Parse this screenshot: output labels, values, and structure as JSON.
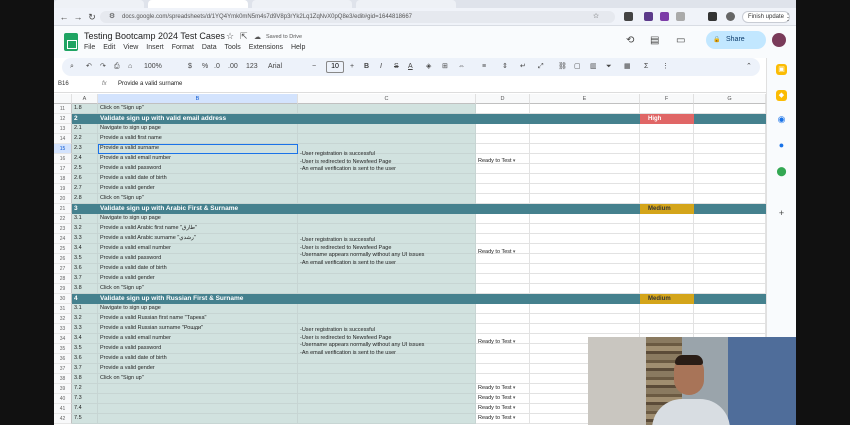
{
  "browser": {
    "url": "docs.google.com/spreadsheets/d/1YQ4Ymk0mN5m4s7d9V8p3rYk2Lq1ZqNvX0pQ8e3/edit#gid=1644818667",
    "finish_update": "Finish update"
  },
  "doc": {
    "title": "Testing Bootcamp 2024 Test Cases",
    "saved": "Saved to Drive",
    "menus": [
      "File",
      "Edit",
      "View",
      "Insert",
      "Format",
      "Data",
      "Tools",
      "Extensions",
      "Help"
    ],
    "share": "Share"
  },
  "toolbar": {
    "zoom": "100%",
    "currency": "$",
    "percent": "%",
    "dec_dec": ".0",
    "dec_inc": ".00",
    "format": "123",
    "font": "Arial",
    "font_size": "10",
    "bold": "B",
    "italic": "I",
    "strike": "S",
    "text_color": "A"
  },
  "formula_bar": {
    "cell": "B16",
    "fx": "fx",
    "content": "Provide a valid surname"
  },
  "columns": [
    "A",
    "B",
    "C",
    "D",
    "E",
    "F",
    "G"
  ],
  "rows": [
    {
      "n": "11",
      "type": "step",
      "a": "1.8",
      "b": "Click on \"Sign up\""
    },
    {
      "n": "12",
      "type": "section",
      "a": "2",
      "b": "Validate sign up with valid email address",
      "priority": "High",
      "pclass": "high"
    },
    {
      "n": "13",
      "type": "step",
      "a": "2.1",
      "b": "Navigate to sign up page"
    },
    {
      "n": "14",
      "type": "step",
      "a": "2.2",
      "b": "Provide a valid first name"
    },
    {
      "n": "15",
      "type": "step",
      "a": "2.3",
      "b": "Provide a valid surname",
      "selected": true
    },
    {
      "n": "16",
      "type": "step",
      "a": "2.4",
      "b": "Provide a valid email number"
    },
    {
      "n": "17",
      "type": "step",
      "a": "2.5",
      "b": "Provide a valid password"
    },
    {
      "n": "18",
      "type": "step",
      "a": "2.6",
      "b": "Provide a valid date of birth"
    },
    {
      "n": "19",
      "type": "step",
      "a": "2.7",
      "b": "Provide a valid gender"
    },
    {
      "n": "20",
      "type": "step",
      "a": "2.8",
      "b": "Click on \"Sign up\""
    },
    {
      "n": "21",
      "type": "section",
      "a": "3",
      "b": "Validate sign up with Arabic First & Surname",
      "priority": "Medium",
      "pclass": "med"
    },
    {
      "n": "22",
      "type": "step",
      "a": "3.1",
      "b": "Navigate to sign up page"
    },
    {
      "n": "23",
      "type": "step",
      "a": "3.2",
      "b": "Provide a valid Arabic first name \"طارق\""
    },
    {
      "n": "24",
      "type": "step",
      "a": "3.3",
      "b": "Provide a valid Arabic surname \"رشدي\""
    },
    {
      "n": "25",
      "type": "step",
      "a": "3.4",
      "b": "Provide a valid email number"
    },
    {
      "n": "26",
      "type": "step",
      "a": "3.5",
      "b": "Provide a valid password"
    },
    {
      "n": "27",
      "type": "step",
      "a": "3.6",
      "b": "Provide a valid date of birth"
    },
    {
      "n": "28",
      "type": "step",
      "a": "3.7",
      "b": "Provide a valid gender"
    },
    {
      "n": "29",
      "type": "step",
      "a": "3.8",
      "b": "Click on \"Sign up\""
    },
    {
      "n": "30",
      "type": "section",
      "a": "4",
      "b": "Validate sign up with Russian First & Surname",
      "priority": "Medium",
      "pclass": "med"
    },
    {
      "n": "31",
      "type": "step",
      "a": "3.1",
      "b": "Navigate to sign up page"
    },
    {
      "n": "32",
      "type": "step",
      "a": "3.2",
      "b": "Provide a valid Russian first name \"Тарека\""
    },
    {
      "n": "33",
      "type": "step",
      "a": "3.3",
      "b": "Provide a valid Russian surname \"Рошди\""
    },
    {
      "n": "34",
      "type": "step",
      "a": "3.4",
      "b": "Provide a valid email number"
    },
    {
      "n": "35",
      "type": "step",
      "a": "3.5",
      "b": "Provide a valid password"
    },
    {
      "n": "36",
      "type": "step",
      "a": "3.6",
      "b": "Provide a valid date of birth"
    },
    {
      "n": "37",
      "type": "step",
      "a": "3.7",
      "b": "Provide a valid gender"
    },
    {
      "n": "38",
      "type": "step",
      "a": "3.8",
      "b": "Click on \"Sign up\""
    },
    {
      "n": "39",
      "type": "step",
      "a": "7.2",
      "b": "",
      "status": "Ready to Test"
    },
    {
      "n": "40",
      "type": "step",
      "a": "7.3",
      "b": "",
      "status": "Ready to Test"
    },
    {
      "n": "41",
      "type": "step",
      "a": "7.4",
      "b": "",
      "status": "Ready to Test"
    },
    {
      "n": "42",
      "type": "step",
      "a": "7.5",
      "b": "",
      "status": "Ready to Test"
    }
  ],
  "expected": [
    {
      "lines": [
        "-User registration is successful",
        "-User is redirected to Newsfeed Page",
        "-An email verification is sent to the user"
      ],
      "status": "Ready to Test"
    },
    {
      "lines": [
        "-User registration is successful",
        "-User is redirected to Newsfeed Page",
        "-Username appears normally without any UI issues",
        "-An email verification is sent to the user"
      ],
      "status": "Ready to Test"
    },
    {
      "lines": [
        "-User registration is successful",
        "-User is redirected to Newsfeed Page",
        "-Username appears normally without any UI issues",
        "-An email verification is sent to the user"
      ],
      "status": "Ready to Test"
    }
  ]
}
